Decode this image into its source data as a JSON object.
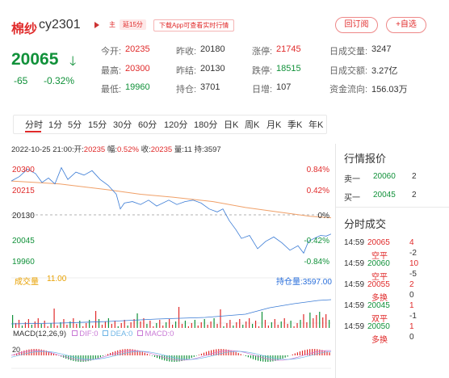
{
  "header": {
    "name": "棉纱",
    "code": "cy2301",
    "badge_main": "主",
    "badge_delay": "延15分",
    "badge_app": "下载App可查看实时行情",
    "btn_subscribe": "回订阅",
    "btn_watch": "+自选"
  },
  "price": {
    "last": "20065",
    "change": "-65",
    "change_pct": "-0.32%"
  },
  "quote": {
    "open_label": "今开:",
    "open": "20235",
    "prev_close_label": "昨收:",
    "prev_close": "20180",
    "limit_up_label": "涨停:",
    "limit_up": "21745",
    "volume_label": "日成交量:",
    "volume": "3247",
    "high_label": "最高:",
    "high": "20300",
    "prev_settle_label": "昨结:",
    "prev_settle": "20130",
    "limit_down_label": "跌停:",
    "limit_down": "18515",
    "turnover_label": "日成交额:",
    "turnover": "3.27亿",
    "low_label": "最低:",
    "low": "19960",
    "oi_label": "持仓:",
    "oi": "3701",
    "daily_inc_label": "日增:",
    "daily_inc": "107",
    "fund_flow_label": "资金流向:",
    "fund_flow": "156.03万"
  },
  "tabs": [
    "分时",
    "1分",
    "5分",
    "15分",
    "30分",
    "60分",
    "120分",
    "180分",
    "日K",
    "周K",
    "月K",
    "季K",
    "年K"
  ],
  "chart": {
    "header": "2022-10-25 21:00:",
    "open_label": "开:",
    "open": "20235",
    "amp_label": "幅:",
    "amp": "0.52%",
    "close_label": "收:",
    "close": "20235",
    "vol_label": "量:",
    "vol": "11",
    "oi_label": "持:",
    "oi": "3597",
    "y_left": [
      "20300",
      "20215",
      "20130",
      "20045",
      "19960"
    ],
    "y_right": [
      "0.84%",
      "0.42%",
      "0%",
      "-0.42%",
      "-0.84%"
    ],
    "vol_name": "成交量",
    "vol_value": "11.00",
    "oi_name": "持仓量",
    "oi_value": "3597.00",
    "macd_name": "MACD(12,26,9)",
    "dif": "DIF:0",
    "dea": "DEA:0",
    "macd": "MACD:0",
    "macd_axis": "20"
  },
  "right_panel": {
    "quotes_title": "行情报价",
    "ask_label": "卖一",
    "ask_price": "20060",
    "ask_qty": "2",
    "bid_label": "买一",
    "bid_price": "20045",
    "bid_qty": "2",
    "trades_title": "分时成交",
    "trades": [
      {
        "time": "14:59",
        "price": "20065",
        "qty": "4",
        "type": "空平",
        "delta": "-2"
      },
      {
        "time": "14:59",
        "price": "20060",
        "qty": "10",
        "type": "空平",
        "delta": "-5"
      },
      {
        "time": "14:59",
        "price": "20055",
        "qty": "2",
        "type": "多换",
        "delta": "0"
      },
      {
        "time": "14:59",
        "price": "20045",
        "qty": "1",
        "type": "双平",
        "delta": "-1"
      },
      {
        "time": "14:59",
        "price": "20050",
        "qty": "1",
        "type": "多换",
        "delta": "0"
      }
    ]
  },
  "colors": {
    "up": "#e02a2a",
    "down": "#11913a",
    "price_line": "#3a7bd5",
    "avg_line": "#f0a068"
  }
}
